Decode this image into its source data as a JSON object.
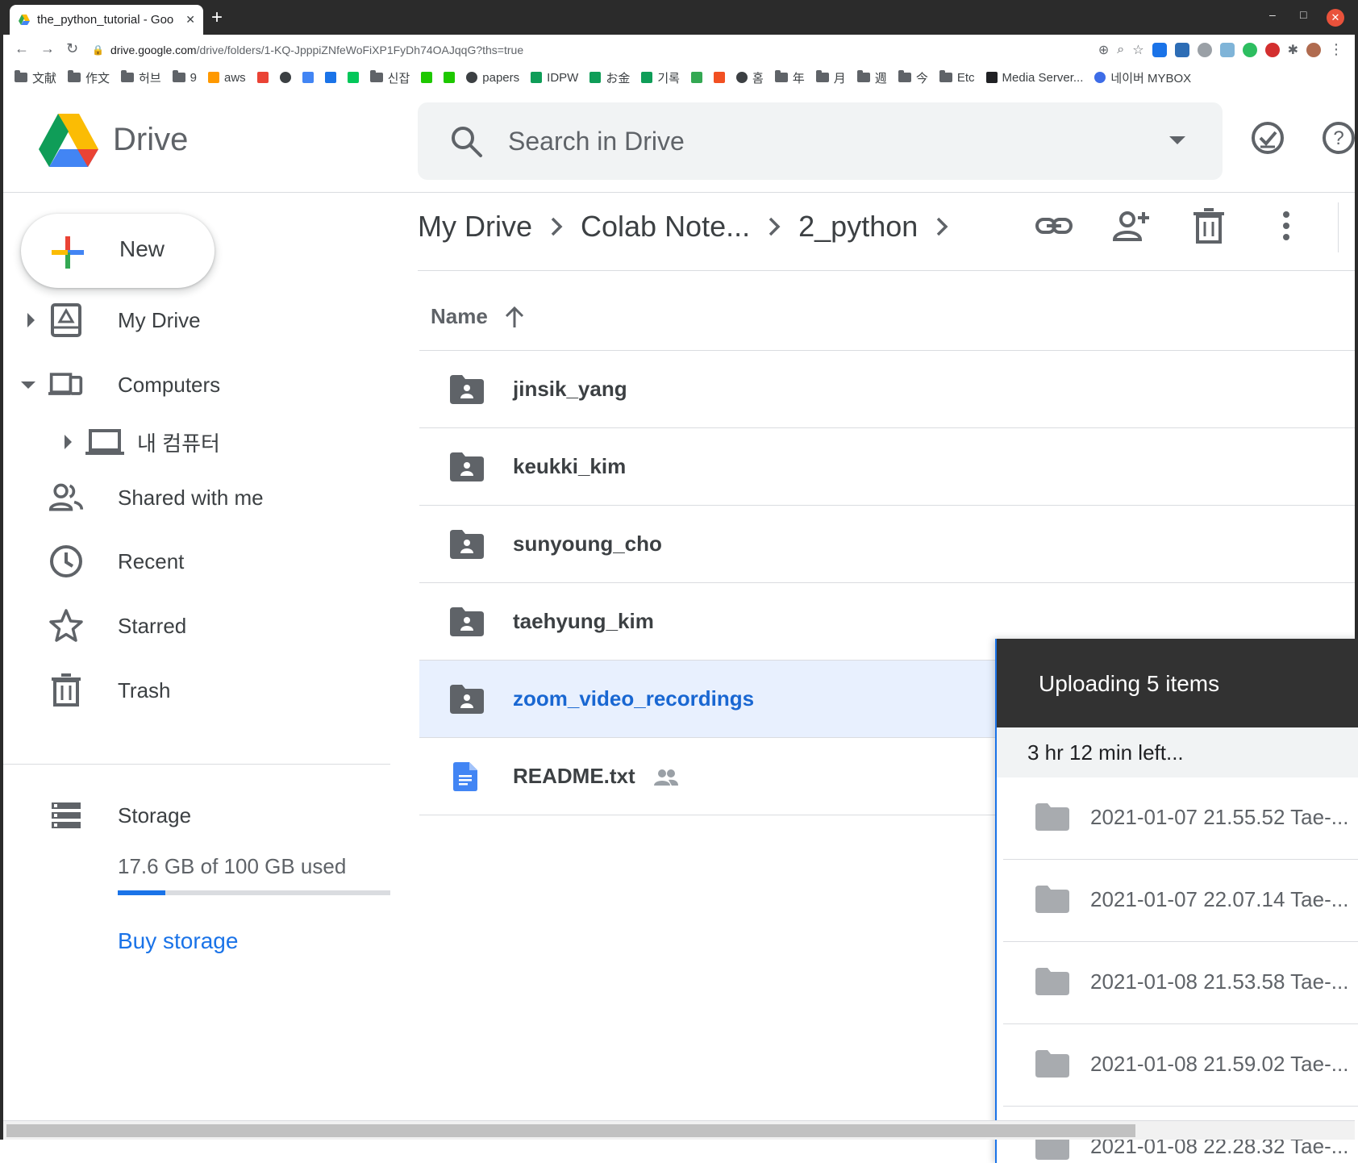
{
  "browser": {
    "tab_title": "the_python_tutorial - Goo",
    "url_host": "drive.google.com",
    "url_path": "/drive/folders/1-KQ-JpppiZNfeWoFiXP1FyDh74OAJqqG?ths=true",
    "bookmarks": [
      "文献",
      "作文",
      "허브",
      "9",
      "aws",
      "신잡",
      "papers",
      "IDPW",
      "お金",
      "기록",
      "홈",
      "年",
      "月",
      "週",
      "今",
      "Etc",
      "Media Server...",
      "네이버 MYBOX"
    ]
  },
  "header": {
    "app_name": "Drive",
    "search_placeholder": "Search in Drive"
  },
  "sidebar": {
    "new_label": "New",
    "items": [
      {
        "label": "My Drive"
      },
      {
        "label": "Computers"
      },
      {
        "label": "내 컴퓨터"
      },
      {
        "label": "Shared with me"
      },
      {
        "label": "Recent"
      },
      {
        "label": "Starred"
      },
      {
        "label": "Trash"
      },
      {
        "label": "Storage"
      }
    ],
    "storage_text": "17.6 GB of 100 GB used",
    "storage_fraction": 0.176,
    "buy_storage": "Buy storage"
  },
  "breadcrumb": [
    "My Drive",
    "Colab Note...",
    "2_python"
  ],
  "list": {
    "column_name": "Name",
    "rows": [
      {
        "name": "jinsik_yang"
      },
      {
        "name": "keukki_kim"
      },
      {
        "name": "sunyoung_cho"
      },
      {
        "name": "taehyung_kim"
      },
      {
        "name": "zoom_video_recordings"
      },
      {
        "name": "README.txt"
      }
    ]
  },
  "upload": {
    "title": "Uploading 5 items",
    "time_left": "3 hr 12 min left...",
    "items": [
      "2021-01-07 21.55.52 Tae-...",
      "2021-01-07 22.07.14 Tae-...",
      "2021-01-08 21.53.58 Tae-...",
      "2021-01-08 21.59.02 Tae-...",
      "2021-01-08 22.28.32 Tae-..."
    ]
  },
  "colors": {
    "accent": "#1a73e8",
    "selected_row": "#e8f0fe",
    "upload_header": "#323232"
  }
}
